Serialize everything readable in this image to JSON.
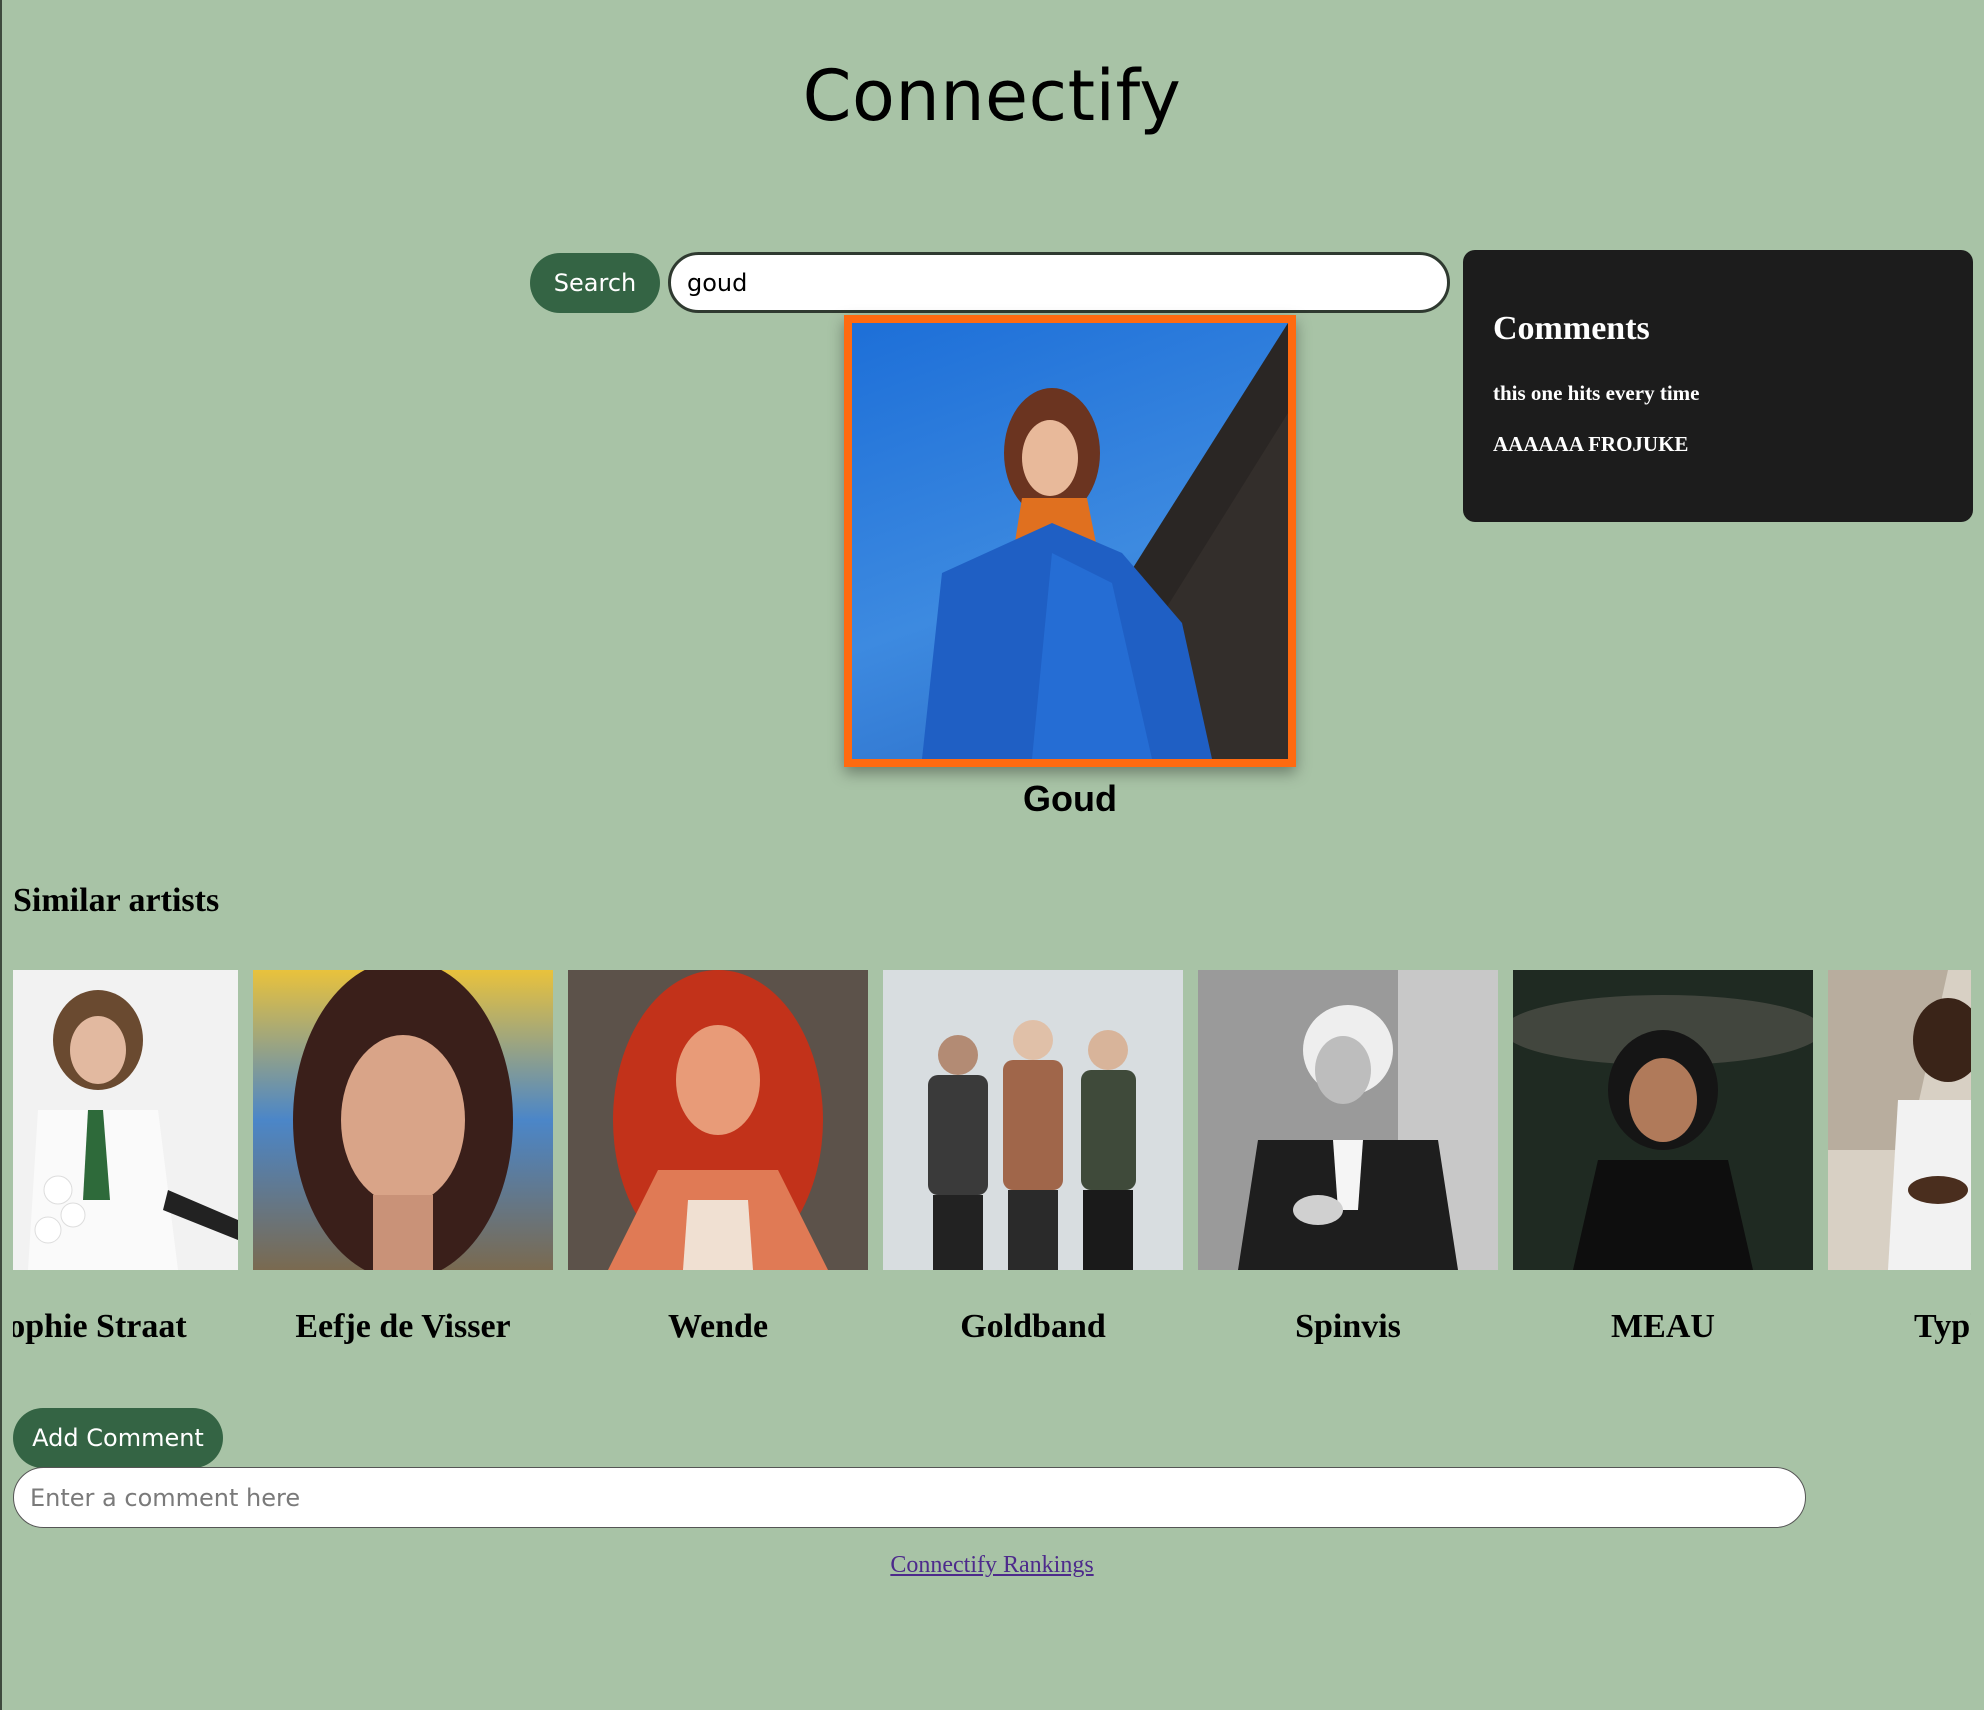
{
  "app": {
    "title": "Connectify"
  },
  "search": {
    "button_label": "Search",
    "value": "goud"
  },
  "artist": {
    "name": "Goud",
    "frame_color": "#ff6a10"
  },
  "comments": {
    "title": "Comments",
    "items": [
      "this one hits every time",
      "AAAAAA FROJUKE"
    ]
  },
  "similar": {
    "heading": "Similar artists",
    "artists": [
      {
        "name": "Sophie Straat"
      },
      {
        "name": "Eefje de Visser"
      },
      {
        "name": "Wende"
      },
      {
        "name": "Goldband"
      },
      {
        "name": "Spinvis"
      },
      {
        "name": "MEAU"
      },
      {
        "name": "Typhoon"
      }
    ]
  },
  "comment_form": {
    "button_label": "Add Comment",
    "placeholder": "Enter a comment here"
  },
  "footer": {
    "rankings_link": "Connectify Rankings"
  },
  "colors": {
    "background": "#a8c3a6",
    "button": "#346444",
    "panel": "#1c1c1c"
  }
}
